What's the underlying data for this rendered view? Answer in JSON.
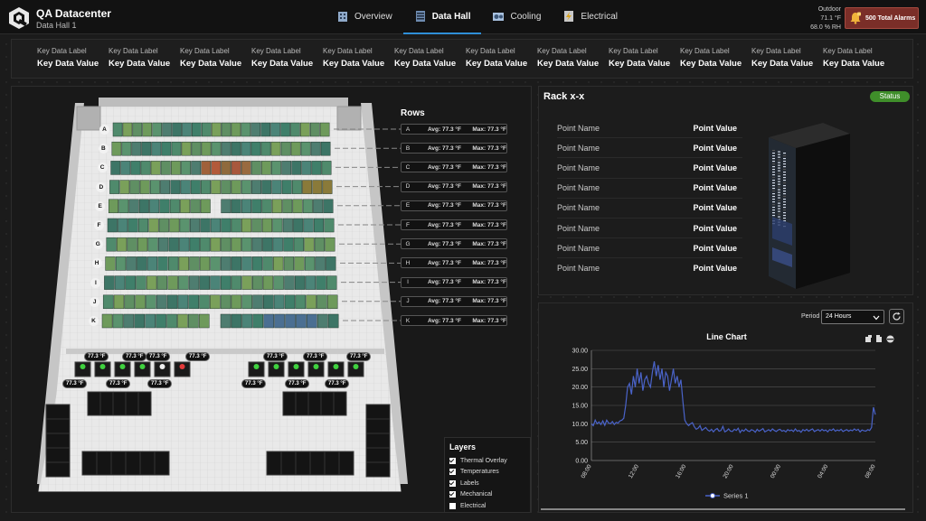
{
  "header": {
    "app_title": "QA Datacenter",
    "app_subtitle": "Data Hall 1",
    "nav": [
      {
        "label": "Overview",
        "icon": "building-icon",
        "active": false
      },
      {
        "label": "Data Hall",
        "icon": "server-rack-icon",
        "active": true
      },
      {
        "label": "Cooling",
        "icon": "cooling-unit-icon",
        "active": false
      },
      {
        "label": "Electrical",
        "icon": "electrical-panel-icon",
        "active": false
      }
    ],
    "outdoor": {
      "label": "Outdoor",
      "temp": "71.1 °F",
      "humidity": "68.0 % RH"
    },
    "alarms_label": "500 Total Alarms"
  },
  "kpis": [
    {
      "label": "Key Data Label",
      "value": "Key Data Value"
    },
    {
      "label": "Key Data Label",
      "value": "Key Data Value"
    },
    {
      "label": "Key Data Label",
      "value": "Key Data Value"
    },
    {
      "label": "Key Data Label",
      "value": "Key Data Value"
    },
    {
      "label": "Key Data Label",
      "value": "Key Data Value"
    },
    {
      "label": "Key Data Label",
      "value": "Key Data Value"
    },
    {
      "label": "Key Data Label",
      "value": "Key Data Value"
    },
    {
      "label": "Key Data Label",
      "value": "Key Data Value"
    },
    {
      "label": "Key Data Label",
      "value": "Key Data Value"
    },
    {
      "label": "Key Data Label",
      "value": "Key Data Value"
    },
    {
      "label": "Key Data Label",
      "value": "Key Data Value"
    },
    {
      "label": "Key Data Label",
      "value": "Key Data Value"
    }
  ],
  "hall": {
    "rows_title": "Rows",
    "rows": [
      {
        "id": "A",
        "avg": "Avg: 77.3 °F",
        "max": "Max: 77.3 °F"
      },
      {
        "id": "B",
        "avg": "Avg: 77.3 °F",
        "max": "Max: 77.3 °F"
      },
      {
        "id": "C",
        "avg": "Avg: 77.3 °F",
        "max": "Max: 77.3 °F"
      },
      {
        "id": "D",
        "avg": "Avg: 77.3 °F",
        "max": "Max: 77.3 °F"
      },
      {
        "id": "E",
        "avg": "Avg: 77.3 °F",
        "max": "Max: 77.3 °F"
      },
      {
        "id": "F",
        "avg": "Avg: 77.3 °F",
        "max": "Max: 77.3 °F"
      },
      {
        "id": "G",
        "avg": "Avg: 77.3 °F",
        "max": "Max: 77.3 °F"
      },
      {
        "id": "H",
        "avg": "Avg: 77.3 °F",
        "max": "Max: 77.3 °F"
      },
      {
        "id": "I",
        "avg": "Avg: 77.3 °F",
        "max": "Max: 77.3 °F"
      },
      {
        "id": "J",
        "avg": "Avg: 77.3 °F",
        "max": "Max: 77.3 °F"
      },
      {
        "id": "K",
        "avg": "Avg: 77.3 °F",
        "max": "Max: 77.3 °F"
      }
    ],
    "unit_temp": "77.3 °F",
    "layers_title": "Layers",
    "layers": [
      {
        "label": "Thermal Overlay",
        "checked": true
      },
      {
        "label": "Temperatures",
        "checked": true
      },
      {
        "label": "Labels",
        "checked": true
      },
      {
        "label": "Mechanical",
        "checked": true
      },
      {
        "label": "Electrical",
        "checked": false
      }
    ]
  },
  "rack": {
    "title": "Rack x-x",
    "status": "Status",
    "status_color": "#3f8e2a",
    "points": [
      {
        "name": "Point Name",
        "value": "Point Value"
      },
      {
        "name": "Point Name",
        "value": "Point Value"
      },
      {
        "name": "Point Name",
        "value": "Point Value"
      },
      {
        "name": "Point Name",
        "value": "Point Value"
      },
      {
        "name": "Point Name",
        "value": "Point Value"
      },
      {
        "name": "Point Name",
        "value": "Point Value"
      },
      {
        "name": "Point Name",
        "value": "Point Value"
      },
      {
        "name": "Point Name",
        "value": "Point Value"
      }
    ]
  },
  "trend": {
    "period_label": "Period",
    "period_value": "24 Hours",
    "period_options": [
      "24 Hours"
    ]
  },
  "chart_data": {
    "type": "line",
    "title": "Line Chart",
    "xlabel": "",
    "ylabel": "",
    "ylim": [
      0,
      30
    ],
    "yticks": [
      "0.00",
      "5.00",
      "10.00",
      "15.00",
      "20.00",
      "25.00",
      "30.00"
    ],
    "xticks": [
      "08:00",
      "12:00",
      "16:00",
      "20:00",
      "00:00",
      "04:00",
      "08:00"
    ],
    "legend_position": "bottom",
    "series": [
      {
        "name": "Series 1",
        "color": "#4a63c9",
        "values": [
          10,
          9.5,
          11,
          10,
          10.5,
          9.8,
          10.8,
          9.6,
          11,
          10.2,
          10,
          10.6,
          9.8,
          10.4,
          10.2,
          10.8,
          11,
          11.5,
          15,
          20,
          21,
          18,
          23,
          20,
          25,
          21,
          24,
          19,
          22,
          23,
          21,
          20,
          24,
          27,
          23,
          26,
          22,
          25,
          20,
          24,
          23,
          19,
          22,
          25,
          21,
          23,
          20,
          22,
          16,
          11,
          10,
          9.5,
          10,
          10.3,
          9.2,
          8.5,
          8.8,
          9.5,
          8.2,
          8.6,
          9,
          8.3,
          8,
          8.5,
          7.8,
          8.4,
          8.7,
          8,
          8.2,
          9.3,
          7.8,
          8.1,
          8.6,
          8,
          7.9,
          8.5,
          8.2,
          8.8,
          7.6,
          8.3,
          8,
          8.6,
          8.1,
          7.9,
          8.4,
          8.2,
          7.7,
          8.5,
          8,
          8.3,
          8.7,
          7.8,
          8.1,
          8.4,
          8,
          8.6,
          8.2,
          7.9,
          8.3,
          8.5,
          8,
          8.2,
          7.8,
          8.4,
          8.1,
          8.3,
          7.9,
          8.6,
          8,
          8.2,
          7.7,
          8.4,
          8.1,
          8.5,
          8,
          8.3,
          8.6,
          7.9,
          8.2,
          8.4,
          8,
          8.5,
          8.1,
          8.3,
          7.8,
          8.4,
          8.2,
          8.6,
          8,
          8.3,
          8.1,
          8.5,
          7.9,
          8.2,
          8.4,
          8,
          8.3,
          8.1,
          8.6,
          8.2,
          8.5,
          7.8,
          8.3,
          8.1,
          8,
          8.4,
          8.2,
          9,
          14.5,
          12.5
        ]
      }
    ]
  }
}
